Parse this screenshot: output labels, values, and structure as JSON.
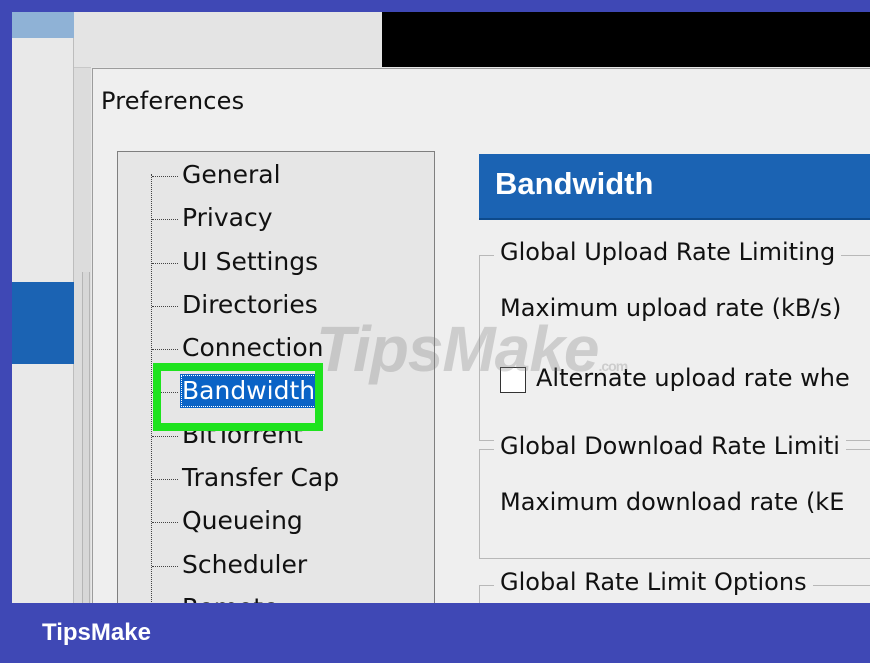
{
  "dialog": {
    "title": "Preferences"
  },
  "tree": {
    "items": [
      {
        "label": "General"
      },
      {
        "label": "Privacy"
      },
      {
        "label": "UI Settings"
      },
      {
        "label": "Directories"
      },
      {
        "label": "Connection"
      },
      {
        "label": "Bandwidth",
        "selected": true
      },
      {
        "label": "BitTorrent"
      },
      {
        "label": "Transfer Cap"
      },
      {
        "label": "Queueing"
      },
      {
        "label": "Scheduler"
      },
      {
        "label": "Remote"
      }
    ]
  },
  "panel": {
    "header": "Bandwidth",
    "upload_group": {
      "title": "Global Upload Rate Limiting",
      "max_rate_label": "Maximum upload rate (kB/s)",
      "alternate_label": "Alternate upload rate whe"
    },
    "download_group": {
      "title": "Global Download Rate Limiti",
      "max_rate_label": "Maximum download rate (kE"
    },
    "options_group": {
      "title": "Global Rate Limit Options"
    }
  },
  "watermark": {
    "text": "TipsMake",
    "suffix": ".com"
  },
  "footer": {
    "brand": "TipsMake"
  },
  "colors": {
    "selection": "#0a63c6",
    "header_blue": "#1b63b3",
    "highlight_green": "#1ee31e",
    "footer_bar": "#3f48b5"
  }
}
